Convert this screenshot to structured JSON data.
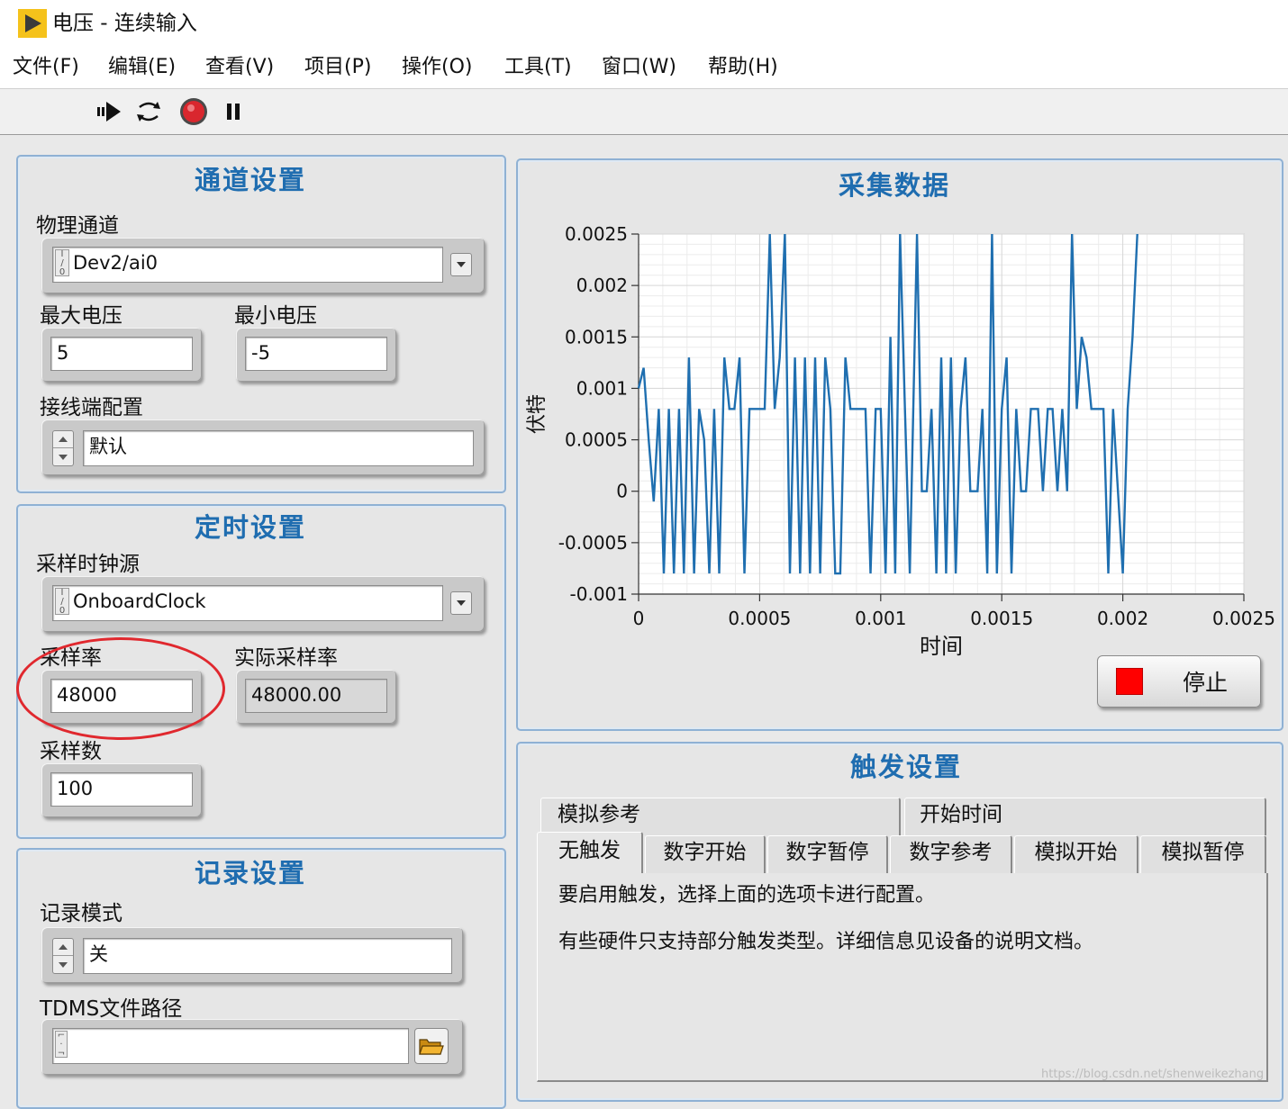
{
  "window": {
    "title": "电压 - 连续输入"
  },
  "menu": [
    "文件(F)",
    "编辑(E)",
    "查看(V)",
    "项目(P)",
    "操作(O)",
    "工具(T)",
    "窗口(W)",
    "帮助(H)"
  ],
  "toolbar": {
    "icons": [
      "run-arrow-icon",
      "run-continuously-icon",
      "abort-icon",
      "pause-icon"
    ]
  },
  "channel": {
    "title": "通道设置",
    "physical_label": "物理通道",
    "physical_value": "Dev2/ai0",
    "max_label": "最大电压",
    "max_value": "5",
    "min_label": "最小电压",
    "min_value": "-5",
    "terminal_label": "接线端配置",
    "terminal_value": "默认"
  },
  "timing": {
    "title": "定时设置",
    "clock_label": "采样时钟源",
    "clock_value": "OnboardClock",
    "rate_label": "采样率",
    "rate_value": "48000",
    "actual_label": "实际采样率",
    "actual_value": "48000.00",
    "samples_label": "采样数",
    "samples_value": "100"
  },
  "logging": {
    "title": "记录设置",
    "mode_label": "记录模式",
    "mode_value": "关",
    "path_label": "TDMS文件路径",
    "path_value": ""
  },
  "acquisition": {
    "title": "采集数据",
    "stop_label": "停止",
    "stop_color": "#ff0000"
  },
  "trigger": {
    "title": "触发设置",
    "tabs_back": [
      "模拟参考",
      "开始时间"
    ],
    "tabs_front": [
      "无触发",
      "数字开始",
      "数字暂停",
      "数字参考",
      "模拟开始",
      "模拟暂停"
    ],
    "text1": "要启用触发，选择上面的选项卡进行配置。",
    "text2": "有些硬件只支持部分触发类型。详细信息见设备的说明文档。"
  },
  "watermark": "https://blog.csdn.net/shenweikezhang",
  "colors": {
    "panel_title": "#1f6db0",
    "panel_border": "#8fb1d4",
    "plot_line": "#1f6fb0",
    "highlight_ellipse": "#e0282e"
  },
  "chart_data": {
    "type": "line",
    "title": "",
    "xlabel": "时间",
    "ylabel": "伏特",
    "xlim": [
      0,
      0.0025
    ],
    "ylim": [
      -0.001,
      0.0025
    ],
    "xticks": [
      "0",
      "0.0005",
      "0.001",
      "0.0015",
      "0.002",
      "0.0025"
    ],
    "yticks": [
      "0.0025",
      "0.002",
      "0.0015",
      "0.001",
      "0.0005",
      "0",
      "-0.0005",
      "-0.001"
    ],
    "grid": true,
    "series": [
      {
        "x": [
          0,
          2.08e-05,
          4.17e-05,
          6.25e-05,
          8.33e-05,
          0.000104,
          0.000125,
          0.000146,
          0.000167,
          0.000187,
          0.000208,
          0.000229,
          0.00025,
          0.000271,
          0.000292,
          0.000312,
          0.000333,
          0.000354,
          0.000375,
          0.000396,
          0.000417,
          0.000437,
          0.000458,
          0.000479,
          0.0005,
          0.000521,
          0.000542,
          0.000562,
          0.000583,
          0.000604,
          0.000625,
          0.000646,
          0.000667,
          0.000687,
          0.000708,
          0.000729,
          0.00075,
          0.000771,
          0.000792,
          0.000812,
          0.000833,
          0.000854,
          0.000875,
          0.000896,
          0.000917,
          0.000937,
          0.000958,
          0.000979,
          0.001,
          0.00102,
          0.00104,
          0.00106,
          0.00108,
          0.0011,
          0.00112,
          0.00115,
          0.00117,
          0.00119,
          0.00121,
          0.00123,
          0.00125,
          0.00127,
          0.00129,
          0.00131,
          0.00133,
          0.00135,
          0.00137,
          0.0014,
          0.00142,
          0.00144,
          0.00146,
          0.00148,
          0.0015,
          0.00152,
          0.00154,
          0.00156,
          0.00158,
          0.0016,
          0.00162,
          0.00165,
          0.00167,
          0.00169,
          0.00171,
          0.00173,
          0.00175,
          0.00177,
          0.00179,
          0.00181,
          0.00183,
          0.00185,
          0.00187,
          0.0019,
          0.00192,
          0.00194,
          0.00196,
          0.00198,
          0.002,
          0.00202,
          0.00204,
          0.00206
        ],
        "y": [
          0.001,
          0.0012,
          0.0005,
          -0.0001,
          0.0008,
          -0.0008,
          0.0008,
          -0.0008,
          0.0008,
          -0.0008,
          0.0013,
          -0.0008,
          0.0008,
          0.0005,
          -0.0008,
          0.0008,
          -0.0008,
          0.0013,
          0.0008,
          0.0008,
          0.0013,
          -0.0008,
          0.0008,
          0.0008,
          0.0008,
          0.0008,
          0.0025,
          0.0008,
          0.0013,
          0.0025,
          -0.0008,
          0.0013,
          -0.0008,
          0.0013,
          -0.0008,
          0.0013,
          -0.0008,
          0.0013,
          0.0008,
          -0.0008,
          -0.0008,
          0.0013,
          0.0008,
          0.0008,
          0.0008,
          0.0008,
          -0.0008,
          0.0008,
          0.0008,
          -0.0008,
          0.0015,
          -0.0008,
          0.0025,
          0.0008,
          -0.0008,
          0.0025,
          0.0,
          0.0,
          0.0008,
          -0.0008,
          0.0013,
          -0.0008,
          0.0013,
          -0.0008,
          0.0008,
          0.0013,
          0.0,
          0.0,
          0.0008,
          -0.0008,
          0.0025,
          -0.0008,
          0.0008,
          0.0013,
          -0.0008,
          0.0008,
          0.0,
          0.0,
          0.0008,
          0.0008,
          0.0,
          0.0008,
          0.0008,
          0.0,
          0.0008,
          0.0,
          0.0025,
          0.0008,
          0.0015,
          0.0013,
          0.0008,
          0.0008,
          0.0008,
          -0.0008,
          0.0008,
          0.0,
          -0.0008,
          0.0008,
          0.0015,
          0.0025
        ]
      }
    ]
  }
}
